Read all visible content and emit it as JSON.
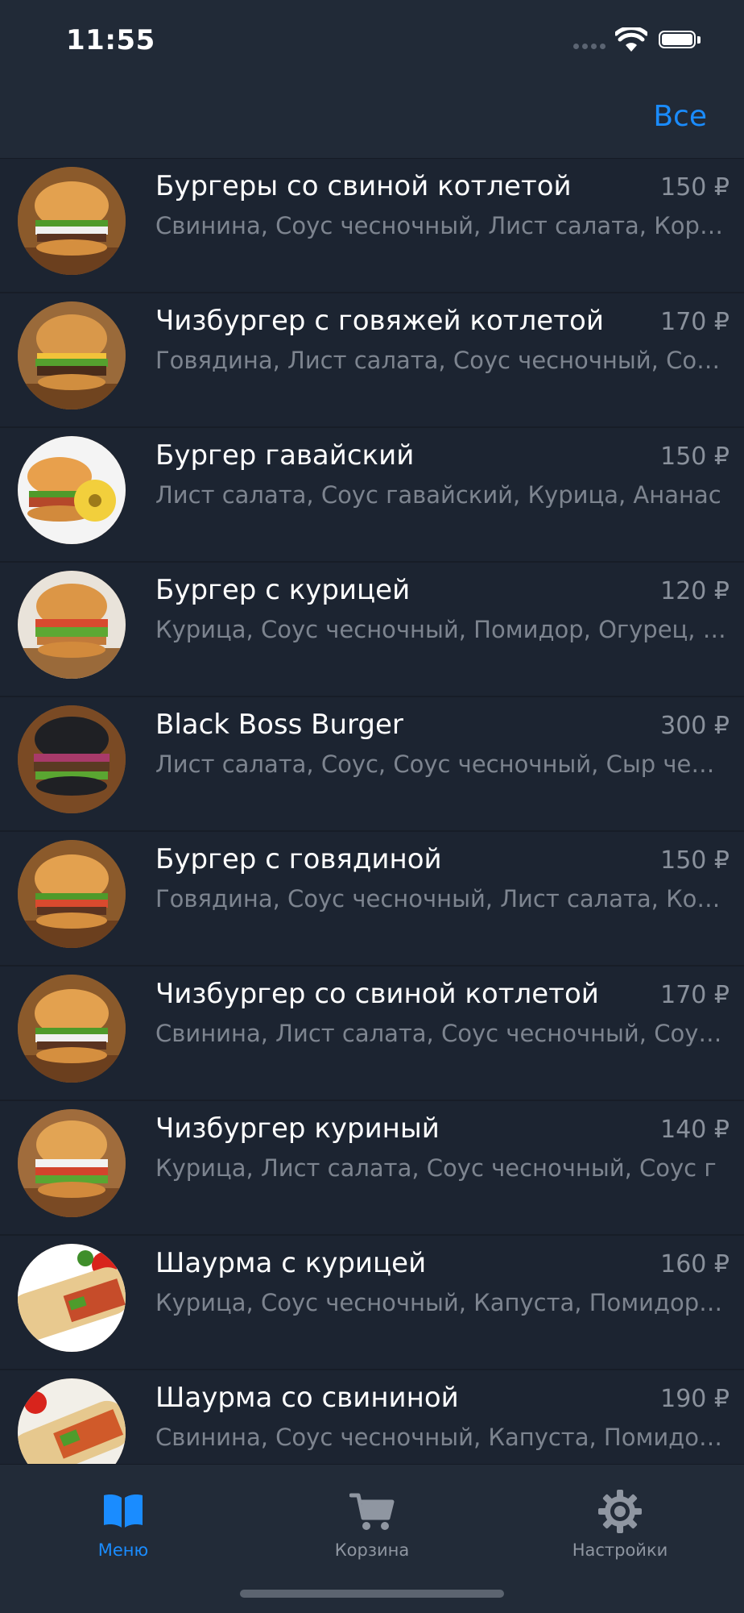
{
  "status": {
    "time": "11:55"
  },
  "nav": {
    "all_label": "Все"
  },
  "menu": [
    {
      "title": "Бургеры со свиной котлетой",
      "price": "150 ₽",
      "desc": "Свинина, Соус чесночный, Лист салата, Корнишоны",
      "image": "burger-thumbnail"
    },
    {
      "title": "Чизбургер с говяжей котлетой",
      "price": "170 ₽",
      "desc": "Говядина, Лист салата, Соус чесночный, Соус гавайский",
      "image": "burger-thumbnail"
    },
    {
      "title": "Бургер гавайский",
      "price": "150 ₽",
      "desc": "Лист салата, Соус гавайский, Курица, Ананас",
      "image": "hawaiian-burger-thumbnail"
    },
    {
      "title": "Бургер с курицей",
      "price": "120 ₽",
      "desc": "Курица, Соус чесночный, Помидор, Огурец, Лист салата",
      "image": "burger-thumbnail"
    },
    {
      "title": "Black Boss Burger",
      "price": "300 ₽",
      "desc": "Лист салата, Соус, Соус чесночный, Сыр чеддер",
      "image": "black-burger-thumbnail"
    },
    {
      "title": "Бургер с говядиной",
      "price": "150 ₽",
      "desc": "Говядина, Соус чесночный, Лист салата, Корнишоны",
      "image": "burger-thumbnail"
    },
    {
      "title": "Чизбургер со свиной котлетой",
      "price": "170 ₽",
      "desc": "Свинина, Лист салата, Соус чесночный, Соус гавайский",
      "image": "burger-thumbnail"
    },
    {
      "title": "Чизбургер куриный",
      "price": "140 ₽",
      "desc": "Курица, Лист салата, Соус чесночный, Соус г",
      "image": "burger-thumbnail"
    },
    {
      "title": "Шаурма с курицей",
      "price": "160 ₽",
      "desc": "Курица, Соус чесночный, Капуста, Помидор, Огурец",
      "image": "shawarma-thumbnail"
    },
    {
      "title": "Шаурма со свининой",
      "price": "190 ₽",
      "desc": "Свинина, Соус чесночный, Капуста, Помидор, Огурец",
      "image": "shawarma-thumbnail"
    }
  ],
  "tabs": [
    {
      "label": "Меню",
      "icon": "book-icon",
      "active": true
    },
    {
      "label": "Корзина",
      "icon": "cart-icon",
      "active": false
    },
    {
      "label": "Настройки",
      "icon": "gear-icon",
      "active": false
    }
  ],
  "colors": {
    "accent": "#1a8cff",
    "background": "#1c2431",
    "bar": "#222b38"
  }
}
